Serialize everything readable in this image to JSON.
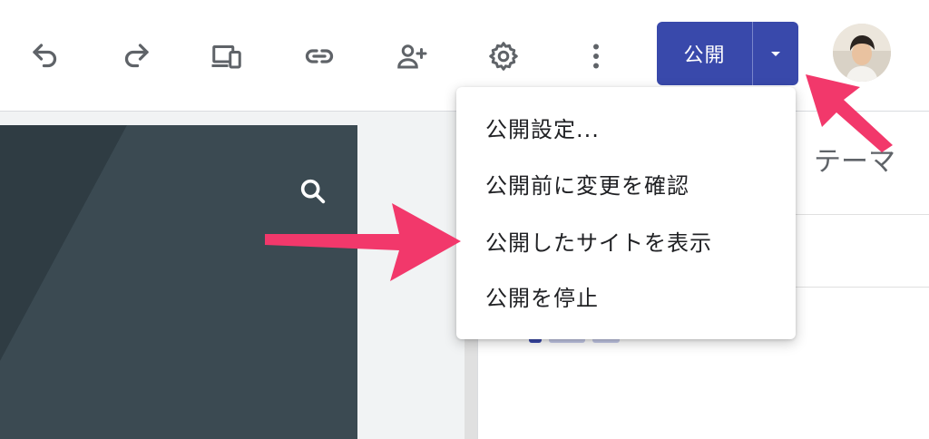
{
  "toolbar": {
    "icons": [
      "undo-icon",
      "redo-icon",
      "device-preview-icon",
      "link-icon",
      "add-person-icon",
      "settings-icon",
      "more-vert-icon"
    ],
    "publish_label": "公開"
  },
  "publish_menu": {
    "items": [
      "公開設定...",
      "公開前に変更を確認",
      "公開したサイトを表示",
      "公開を停止"
    ]
  },
  "side_panel": {
    "tab_label": "テーマ"
  },
  "colors": {
    "publish_button": "#3949ab",
    "annotation_arrow": "#f2386b",
    "preview_background": "#37474f"
  }
}
